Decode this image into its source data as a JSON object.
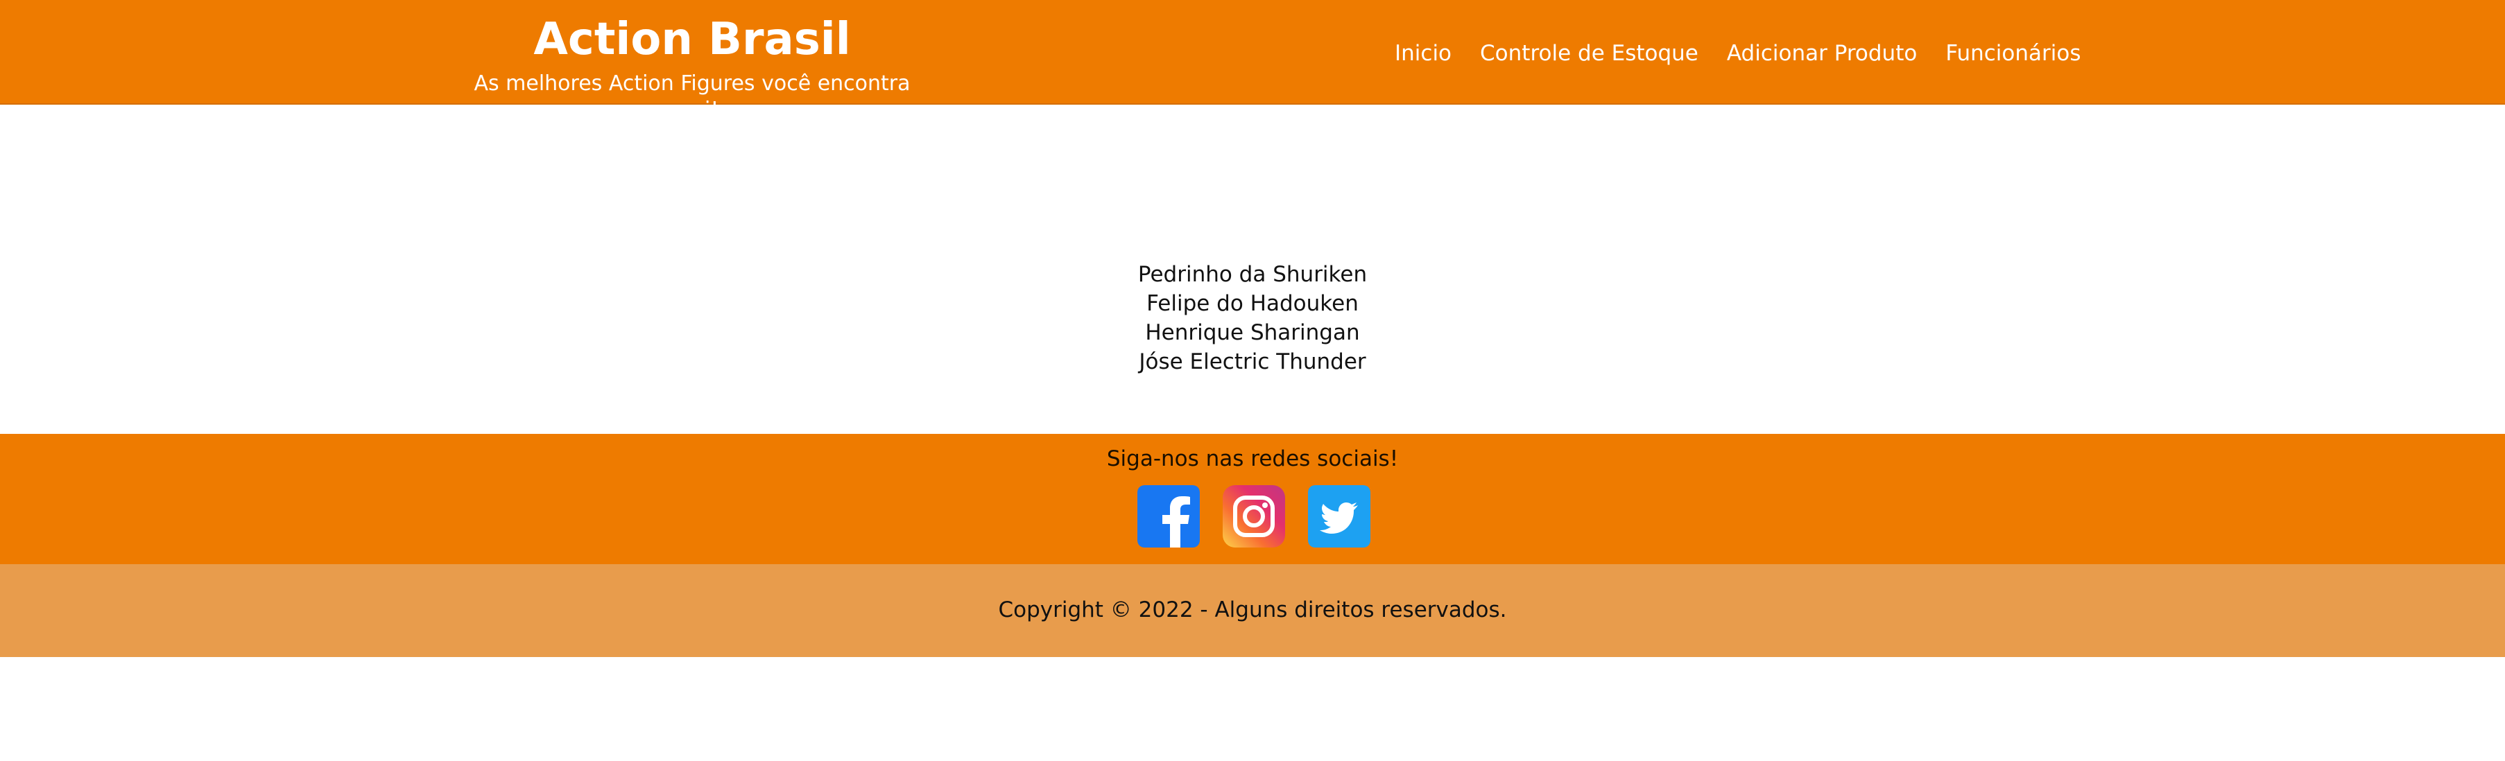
{
  "header": {
    "title": "Action Brasil",
    "subtitle": "As melhores Action Figures você encontra aqui!",
    "nav": [
      "Inicio",
      "Controle de Estoque",
      "Adicionar Produto",
      "Funcionários"
    ]
  },
  "main": {
    "members": [
      "Pedrinho da Shuriken",
      "Felipe do Hadouken",
      "Henrique Sharingan",
      "Jóse Electric Thunder"
    ]
  },
  "social": {
    "title": "Siga-nos nas redes sociais!",
    "icons": [
      "facebook-icon",
      "instagram-icon",
      "twitter-icon"
    ]
  },
  "footer": {
    "copyright": "Copyright © 2022 - Alguns direitos reservados."
  },
  "colors": {
    "header_bg": "#ee7b00",
    "social_bg": "#ee7b00",
    "footer_bg": "#e89c4c",
    "facebook": "#1877f2",
    "twitter": "#1da1f2"
  }
}
